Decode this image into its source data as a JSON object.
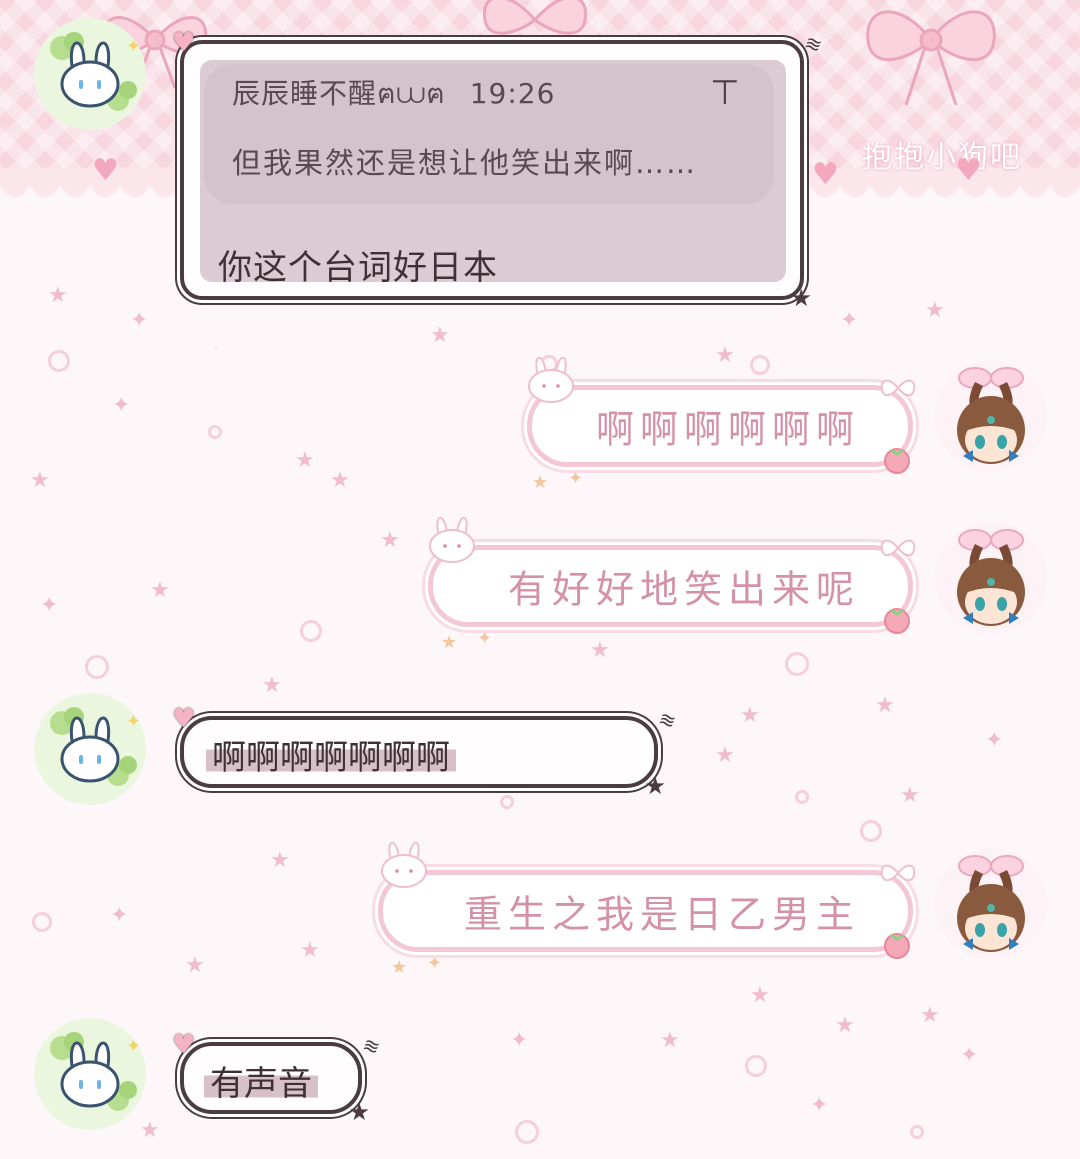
{
  "banner": {
    "watermark": "抱抱小狗吧"
  },
  "messages": {
    "reply": {
      "quoted_sender": "辰辰睡不醒ฅ⩊ฅ",
      "quoted_time": "19:26",
      "quoted_text": "但我果然还是想让他笑出来啊……",
      "text": "你这个台词好日本"
    },
    "m1": {
      "text": "啊啊啊啊啊啊"
    },
    "m2": {
      "text": "有好好地笑出来呢"
    },
    "m3": {
      "text": "啊啊啊啊啊啊啊"
    },
    "m4": {
      "text": "重生之我是日乙男主"
    },
    "m5": {
      "text": "有声音"
    }
  },
  "colors": {
    "bubble_left_border": "#4b3c42",
    "bubble_right_border": "#f3c7d4",
    "right_text": "#d492a7",
    "banner_pink": "#f8d6e0"
  },
  "icons": [
    "bunny-clover-avatar",
    "bunny-ear-girl-avatar",
    "heart-icon",
    "star-icon",
    "bow-icon",
    "strawberry-icon",
    "pin-top-icon"
  ]
}
